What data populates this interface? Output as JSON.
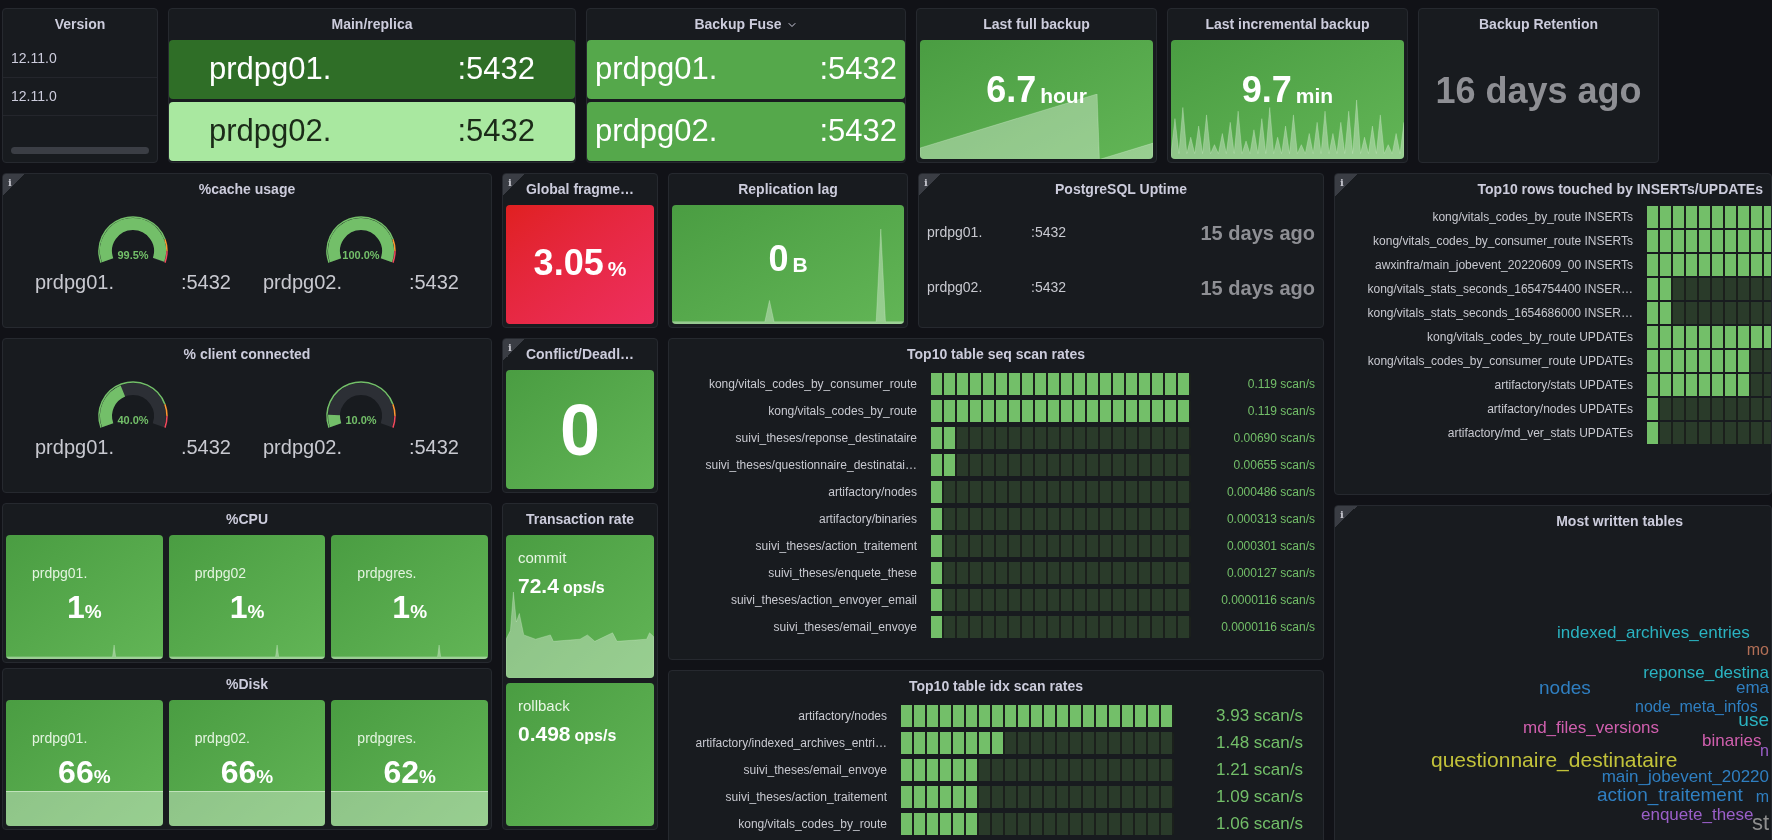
{
  "version": {
    "title": "Version",
    "rows": [
      "12.11.0",
      "12.11.0"
    ]
  },
  "main_replica": {
    "title": "Main/replica",
    "hosts": [
      {
        "name": "prdpg01.",
        "port": ":5432",
        "color": "#2f6e27"
      },
      {
        "name": "prdpg02.",
        "port": ":5432",
        "color": "#a9e8a0"
      }
    ]
  },
  "backup_fuse": {
    "title": "Backup Fuse",
    "hosts": [
      {
        "name": "prdpg01.",
        "port": ":5432",
        "color": "#55a84b"
      },
      {
        "name": "prdpg02.",
        "port": ":5432",
        "color": "#55a84b"
      }
    ]
  },
  "last_full_backup": {
    "title": "Last full backup",
    "value": "6.7",
    "unit": "hour"
  },
  "last_incremental_backup": {
    "title": "Last incremental backup",
    "value": "9.7",
    "unit": "min"
  },
  "backup_retention": {
    "title": "Backup Retention",
    "value": "16 days ago"
  },
  "cache_usage": {
    "title": "%cache usage",
    "info": "i",
    "gauges": [
      {
        "reading": "99.5%",
        "name": "prdpg01.",
        "port": ":5432"
      },
      {
        "reading": "100.0%",
        "name": "prdpg02.",
        "port": ":5432"
      }
    ]
  },
  "global_fragmentation": {
    "title": "Global fragme…",
    "info": "i",
    "value": "3.05",
    "unit": "%"
  },
  "replication_lag": {
    "title": "Replication lag",
    "value": "0",
    "unit": "B"
  },
  "uptime": {
    "title": "PostgreSQL Uptime",
    "info": "i",
    "rows": [
      {
        "name": "prdpg01.",
        "port": ":5432",
        "value": "15 days ago"
      },
      {
        "name": "prdpg02.",
        "port": ":5432",
        "value": "15 days ago"
      }
    ]
  },
  "top_rows": {
    "title": "Top10 rows touched by INSERTs/UPDATEs",
    "info": "i",
    "rows": [
      {
        "label": "kong/vitals_codes_by_route INSERTs",
        "level": 1.0
      },
      {
        "label": "kong/vitals_codes_by_consumer_route INSERTs",
        "level": 1.0
      },
      {
        "label": "awxinfra/main_jobevent_20220609_00 INSERTs",
        "level": 1.0
      },
      {
        "label": "kong/vitals_stats_seconds_1654754400 INSER…",
        "level": 0.2
      },
      {
        "label": "kong/vitals_stats_seconds_1654686000 INSER…",
        "level": 0.2
      },
      {
        "label": "kong/vitals_codes_by_route UPDATEs",
        "level": 1.0
      },
      {
        "label": "kong/vitals_codes_by_consumer_route UPDATEs",
        "level": 0.8
      },
      {
        "label": "artifactory/stats UPDATEs",
        "level": 0.8
      },
      {
        "label": "artifactory/nodes UPDATEs",
        "level": 0.1
      },
      {
        "label": "artifactory/md_ver_stats UPDATEs",
        "level": 0.1
      }
    ]
  },
  "client_connected": {
    "title": "% client connected",
    "gauges": [
      {
        "reading": "40.0%",
        "name": "prdpg01.",
        "port": ".5432"
      },
      {
        "reading": "10.0%",
        "name": "prdpg02.",
        "port": ":5432"
      }
    ]
  },
  "conflict": {
    "title": "Conflict/Deadl…",
    "info": "i",
    "value": "0"
  },
  "seq_scan": {
    "title": "Top10 table seq scan rates",
    "rows": [
      {
        "label": "kong/vitals_codes_by_consumer_route",
        "level": 1.0,
        "reading": "0.119 scan/s"
      },
      {
        "label": "kong/vitals_codes_by_route",
        "level": 1.0,
        "reading": "0.119 scan/s"
      },
      {
        "label": "suivi_theses/reponse_destinataire",
        "level": 0.1,
        "reading": "0.00690 scan/s"
      },
      {
        "label": "suivi_theses/questionnaire_destinatai…",
        "level": 0.1,
        "reading": "0.00655 scan/s"
      },
      {
        "label": "artifactory/nodes",
        "level": 0.05,
        "reading": "0.000486 scan/s"
      },
      {
        "label": "artifactory/binaries",
        "level": 0.05,
        "reading": "0.000313 scan/s"
      },
      {
        "label": "suivi_theses/action_traitement",
        "level": 0.05,
        "reading": "0.000301 scan/s"
      },
      {
        "label": "suivi_theses/enquete_these",
        "level": 0.05,
        "reading": "0.000127 scan/s"
      },
      {
        "label": "suivi_theses/action_envoyer_email",
        "level": 0.05,
        "reading": "0.0000116 scan/s"
      },
      {
        "label": "suivi_theses/email_envoye",
        "level": 0.05,
        "reading": "0.0000116 scan/s"
      }
    ]
  },
  "cpu": {
    "title": "%CPU",
    "stats": [
      {
        "name": "prdpg01.",
        "value": "1",
        "unit": "%"
      },
      {
        "name": "prdpg02",
        "value": "1",
        "unit": "%"
      },
      {
        "name": "prdpgres.",
        "value": "1",
        "unit": "%"
      }
    ]
  },
  "disk": {
    "title": "%Disk",
    "stats": [
      {
        "name": "prdpg01.",
        "value": "66",
        "unit": "%"
      },
      {
        "name": "prdpg02.",
        "value": "66",
        "unit": "%"
      },
      {
        "name": "prdpgres.",
        "value": "62",
        "unit": "%"
      }
    ]
  },
  "transaction_rate": {
    "title": "Transaction rate",
    "series": [
      {
        "name": "commit",
        "value": "72.4",
        "unit": "ops/s",
        "kind": "graph"
      },
      {
        "name": "rollback",
        "value": "0.498",
        "unit": "ops/s",
        "kind": "flat"
      }
    ]
  },
  "idx_scan": {
    "title": "Top10 table idx scan rates",
    "rows": [
      {
        "label": "artifactory/nodes",
        "level": 1.0,
        "reading": "3.93 scan/s"
      },
      {
        "label": "artifactory/indexed_archives_entri…",
        "level": 0.38,
        "reading": "1.48 scan/s"
      },
      {
        "label": "suivi_theses/email_envoye",
        "level": 0.29,
        "reading": "1.21 scan/s"
      },
      {
        "label": "suivi_theses/action_traitement",
        "level": 0.29,
        "reading": "1.09 scan/s"
      },
      {
        "label": "kong/vitals_codes_by_route",
        "level": 0.29,
        "reading": "1.06 scan/s"
      }
    ]
  },
  "most_written": {
    "title": "Most written tables",
    "info": "i",
    "words": [
      {
        "text": "indexed_archives_entries",
        "color": "#2ab3c1"
      },
      {
        "text": "mo",
        "color": "#b26f56"
      },
      {
        "text": "reponse_destina",
        "color": "#2ab3c1"
      },
      {
        "text": "nodes",
        "color": "#2f7fc1"
      },
      {
        "text": "ema",
        "color": "#2f7fc1"
      },
      {
        "text": "node_meta_infos",
        "color": "#2f7fc1"
      },
      {
        "text": "use",
        "color": "#2ab3c1"
      },
      {
        "text": "md_files_versions",
        "color": "#d05fae"
      },
      {
        "text": "binaries",
        "color": "#d05fae"
      },
      {
        "text": "n",
        "color": "#9b5fc9"
      },
      {
        "text": "questionnaire_destinataire",
        "color": "#c2c23a"
      },
      {
        "text": "main_jobevent_20220",
        "color": "#2f7fc1"
      },
      {
        "text": "action_traitement",
        "color": "#2f7fc1"
      },
      {
        "text": "m",
        "color": "#2f7fc1"
      },
      {
        "text": "enquete_these",
        "color": "#9b5fc9"
      },
      {
        "text": "st",
        "color": "#8e8e8e"
      }
    ]
  }
}
